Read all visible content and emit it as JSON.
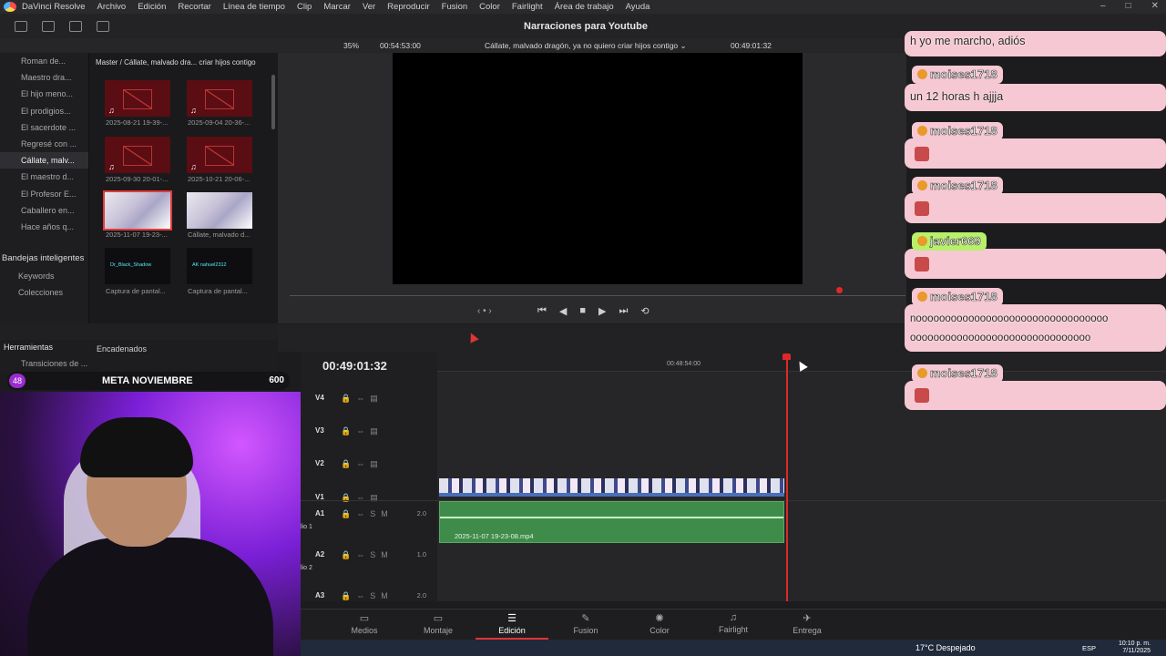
{
  "menu": {
    "app": "DaVinci Resolve",
    "items": [
      "Archivo",
      "Edición",
      "Recortar",
      "Línea de tiempo",
      "Clip",
      "Marcar",
      "Ver",
      "Reproducir",
      "Fusion",
      "Color",
      "Fairlight",
      "Área de trabajo",
      "Ayuda"
    ]
  },
  "toolbar": {
    "project_title": "Narraciones para Youtube"
  },
  "viewer_header": {
    "zoom": "35%",
    "source_timecode": "00:54:53:00",
    "clip_name": "Cállate, malvado dragón, ya no quiero criar hijos contigo ⌄",
    "timecode": "00:49:01:32"
  },
  "bins": {
    "items": [
      "Roman de...",
      "Maestro dra...",
      "El hijo meno...",
      "El prodigios...",
      "El sacerdote ...",
      "Regresé con ...",
      "Cállate, malv...",
      "El maestro d...",
      "El Profesor E...",
      "Caballero en...",
      "Hace años q..."
    ],
    "active_index": 6,
    "smart_title": "Bandejas inteligentes",
    "smart_items": [
      "Keywords",
      "Colecciones"
    ]
  },
  "media_pool": {
    "breadcrumb": "Master / Cállate, malvado dra... criar hijos contigo",
    "clips": [
      {
        "name": "2025-08-21 19-39-...",
        "kind": "empty"
      },
      {
        "name": "2025-09-04 20-36-...",
        "kind": "empty"
      },
      {
        "name": "2025-09-30 20-01-...",
        "kind": "empty"
      },
      {
        "name": "2025-10-21 20-06-...",
        "kind": "empty"
      },
      {
        "name": "2025-11-07 19-23-...",
        "kind": "img"
      },
      {
        "name": "Cállate, malvado d...",
        "kind": "img"
      },
      {
        "name": "Captura de pantal...",
        "kind": "cap",
        "overlay": "Dr_Black_Shadow"
      },
      {
        "name": "Captura de pantal...",
        "kind": "cap",
        "overlay": "AK nahuel2312"
      }
    ]
  },
  "effects": {
    "title": "Herramientas",
    "section": "Encadenados",
    "item": "Transiciones de ..."
  },
  "stream_goal": {
    "count": "48",
    "label": "META NOVIEMBRE",
    "target": "600"
  },
  "timeline": {
    "timecode": "00:49:01:32",
    "ruler_label": "00:48:54:00",
    "tracks": [
      {
        "name": "V4",
        "vol": "",
        "sub": ""
      },
      {
        "name": "V3",
        "vol": "",
        "sub": ""
      },
      {
        "name": "V2",
        "vol": "",
        "sub": ""
      },
      {
        "name": "V1",
        "vol": "",
        "sub": ""
      },
      {
        "name": "A1",
        "vol": "2.0",
        "sub": "lio 1"
      },
      {
        "name": "A2",
        "vol": "1.0",
        "sub": "lio 2"
      },
      {
        "name": "A3",
        "vol": "2.0",
        "sub": ""
      }
    ],
    "audio_clip": "2025-11-07 19-23-08.mp4"
  },
  "pages": [
    "Medios",
    "Montaje",
    "Edición",
    "Fusion",
    "Color",
    "Fairlight",
    "Entrega"
  ],
  "active_page": "Edición",
  "taskbar": {
    "weather": "17°C  Despejado",
    "lang": "ESP",
    "time": "10:10 p. m.",
    "date": "7/11/2025"
  },
  "chat": [
    {
      "user": "",
      "text": "h yo me marcho, adiós"
    },
    {
      "user": "moises1718",
      "text": "un 12 horas h ajjja"
    },
    {
      "user": "moises1718",
      "text": "",
      "emote": true
    },
    {
      "user": "moises1718",
      "text": "",
      "emote": true
    },
    {
      "user": "javier669",
      "text": "",
      "emote": true
    },
    {
      "user": "moises1718",
      "text": "nooooooooooooooooooooooooooooooooo",
      "text2": "ooooooooooooooooooooooooooooooo"
    },
    {
      "user": "moises1718",
      "text": "",
      "emote": true
    }
  ],
  "colors": {
    "accent": "#e03535",
    "chat_bg": "#f6c8d3",
    "audio_clip": "#3f8c4a"
  }
}
